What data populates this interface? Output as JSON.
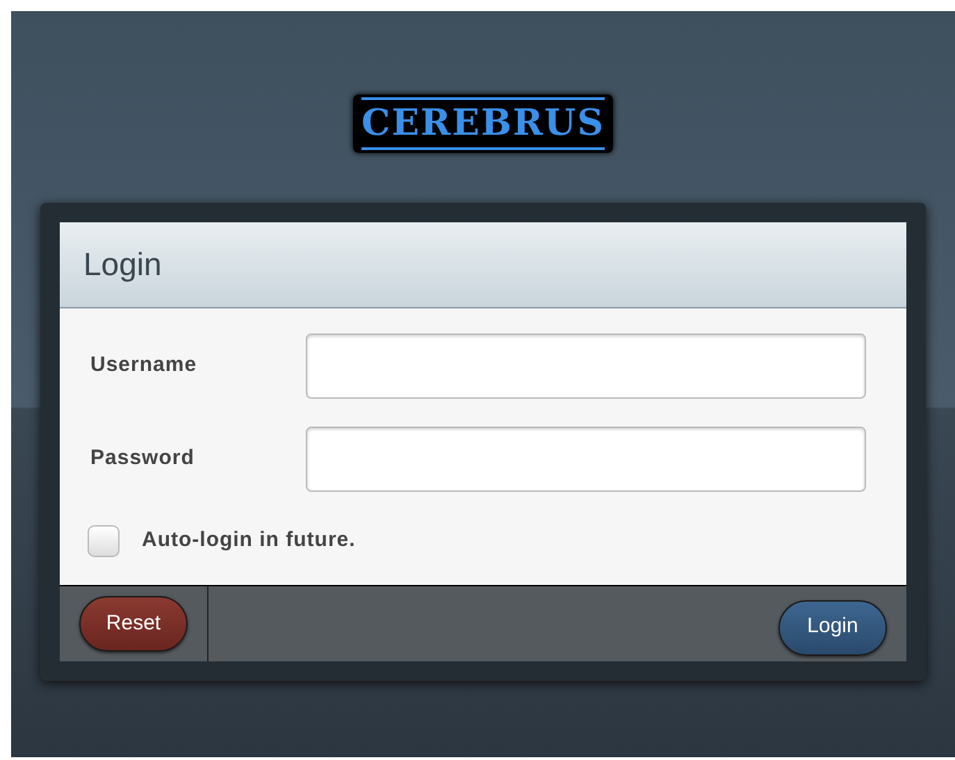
{
  "logo": {
    "text": "CEREBRUS"
  },
  "dialog": {
    "title": "Login",
    "fields": [
      {
        "label": "Username"
      },
      {
        "label": "Password"
      }
    ],
    "auto_login": {
      "label": "Auto-login in future.",
      "checked": false
    },
    "buttons": [
      {
        "label": "Reset",
        "kind": "reset"
      },
      {
        "label": "Login",
        "kind": "submit"
      }
    ]
  }
}
